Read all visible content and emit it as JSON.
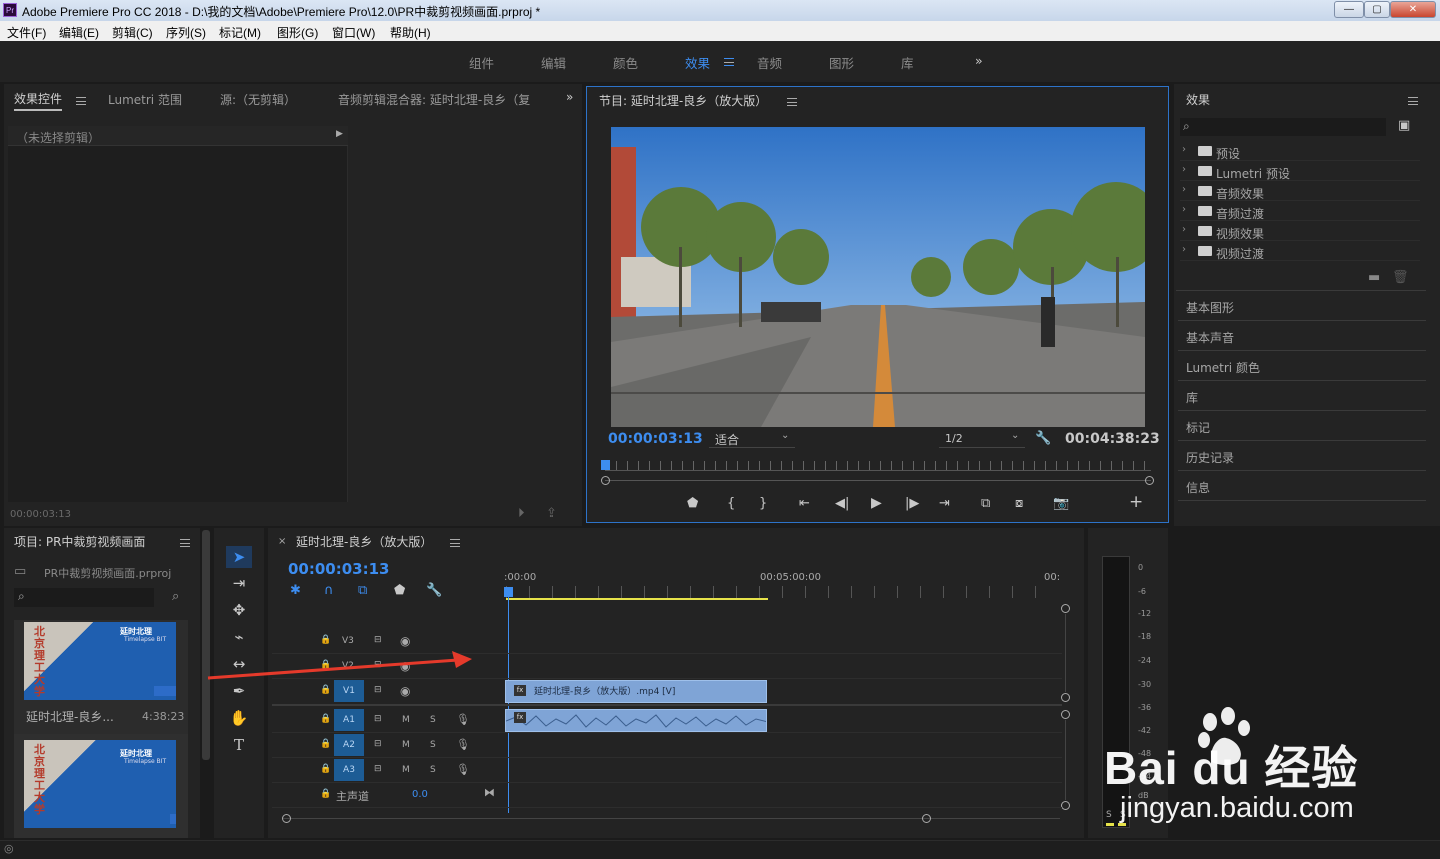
{
  "app": {
    "title": "Adobe Premiere Pro CC 2018 - D:\\我的文档\\Adobe\\Premiere Pro\\12.0\\PR中裁剪视频画面.prproj *",
    "logo": "Pr"
  },
  "window_controls": {
    "minimize": "—",
    "maximize": "▢",
    "close": "✕"
  },
  "menu": [
    "文件(F)",
    "编辑(E)",
    "剪辑(C)",
    "序列(S)",
    "标记(M)",
    "图形(G)",
    "窗口(W)",
    "帮助(H)"
  ],
  "workspaces": {
    "items": [
      "组件",
      "编辑",
      "颜色",
      "效果",
      "音频",
      "图形",
      "库"
    ],
    "active": "效果",
    "more": "»"
  },
  "source_panel": {
    "tabs": [
      "效果控件",
      "Lumetri 范围",
      "源:（无剪辑）",
      "音频剪辑混合器: 延时北理-良乡（复"
    ],
    "more": "»",
    "no_clip": "（未选择剪辑）",
    "timecode": "00:00:03:13"
  },
  "program": {
    "title": "节目: 延时北理-良乡（放大版）",
    "timecode": "00:00:03:13",
    "fit": "适合",
    "resolution": "1/2",
    "duration": "00:04:38:23"
  },
  "effects": {
    "title": "效果",
    "tree": [
      "预设",
      "Lumetri 预设",
      "音频效果",
      "音频过渡",
      "视频效果",
      "视频过渡"
    ],
    "sections": [
      "基本图形",
      "基本声音",
      "Lumetri 颜色",
      "库",
      "标记",
      "历史记录",
      "信息"
    ]
  },
  "project": {
    "title": "项目: PR中裁剪视频画面",
    "file": "PR中裁剪视频画面.prproj",
    "clips": [
      {
        "name": "延时北理-良乡...",
        "duration": "4:38:23",
        "thumb_title": "延时北理",
        "thumb_sub": "Timelapse BIT",
        "thumb_vertical": "北京理工大学"
      },
      {
        "name": "",
        "duration": "",
        "thumb_title": "延时北理",
        "thumb_sub": "Timelapse BIT",
        "thumb_vertical": "北京理工大学"
      }
    ]
  },
  "timeline": {
    "title": "延时北理-良乡（放大版）",
    "timecode": "00:00:03:13",
    "ruler": [
      ":00:00",
      "00:05:00:00",
      "00:"
    ],
    "tracks": [
      {
        "id": "V3",
        "label": "V3"
      },
      {
        "id": "V2",
        "label": "V2"
      },
      {
        "id": "V1",
        "label": "V1"
      },
      {
        "id": "A1",
        "label": "A1"
      },
      {
        "id": "A2",
        "label": "A2"
      },
      {
        "id": "A3",
        "label": "A3"
      }
    ],
    "track_buttons": {
      "mute": "M",
      "solo": "S"
    },
    "master": {
      "label": "主声道",
      "value": "0.0"
    },
    "clip": {
      "video": "延时北理-良乡（放大版）.mp4 [V]",
      "fx": "fx"
    }
  },
  "meter": {
    "labels": [
      "0",
      "-6",
      "-12",
      "-18",
      "-24",
      "-30",
      "-36",
      "-42",
      "-48",
      "-54",
      "dB"
    ],
    "bottom": [
      "S",
      "S"
    ]
  },
  "watermark": {
    "text": "Bai du 经验",
    "url": "jingyan.baidu.com"
  },
  "colors": {
    "accent": "#3d8df0",
    "track_active": "#1d5c95",
    "clip": "#7fa4d6",
    "bg": "#232323"
  }
}
